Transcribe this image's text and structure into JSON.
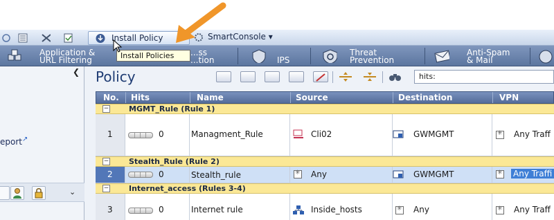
{
  "toolbar": {
    "install_policy_label": "Install Policy",
    "smartconsole_label": "SmartConsole ▾"
  },
  "tooltip": {
    "text": "Install Policies"
  },
  "tabs": [
    {
      "line1": "Application &",
      "line2": "URL Filtering"
    },
    {
      "line1": "...ss",
      "line2": "...tion"
    },
    {
      "line1": "",
      "line2": "IPS"
    },
    {
      "line1": "Threat",
      "line2": "Prevention"
    },
    {
      "line1": "Anti-Spam",
      "line2": "& Mail"
    }
  ],
  "left_panel": {
    "report_label": "eport"
  },
  "policy": {
    "title": "Policy",
    "search_value": "hits:"
  },
  "table": {
    "headers": {
      "no": "No.",
      "hits": "Hits",
      "name": "Name",
      "source": "Source",
      "destination": "Destination",
      "vpn": "VPN"
    },
    "sections": [
      {
        "name": "MGMT_Rule   (Rule 1)"
      },
      {
        "name": "Stealth_Rule   (Rule 2)"
      },
      {
        "name": "Internet_access   (Rules 3-4)"
      }
    ],
    "rows": [
      {
        "no": "1",
        "hits": "0",
        "name": "Managment_Rule",
        "source": "Cli02",
        "destination": "GWMGMT",
        "vpn": "Any Traff"
      },
      {
        "no": "2",
        "hits": "0",
        "name": "Stealth_rule",
        "source": "Any",
        "destination": "GWMGMT",
        "vpn": "Any Traffi"
      },
      {
        "no": "3",
        "hits": "0",
        "name": "Internet rule",
        "source": "Inside_hosts",
        "destination": "Any",
        "vpn": "Any Traff"
      }
    ]
  },
  "colors": {
    "accent_arrow": "#f0962a",
    "section_bg": "#fbe896",
    "header_bg": "#546c9a",
    "selected_row": "#cfe0f6"
  }
}
